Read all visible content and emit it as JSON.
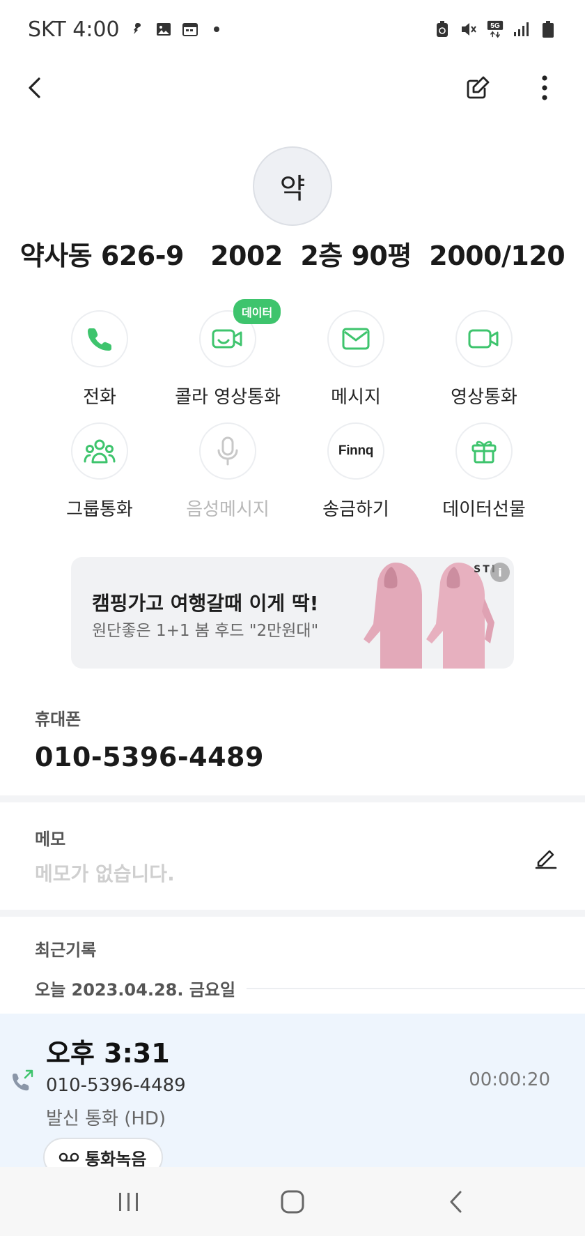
{
  "status_bar": {
    "carrier_time": "SKT 4:00",
    "network_badge": "5G",
    "icons_left": [
      "notification-icon",
      "image-icon",
      "calendar-icon",
      "dot-icon"
    ],
    "icons_right": [
      "battery-saver-icon",
      "mute-icon",
      "network-5g-icon",
      "signal-icon",
      "battery-icon"
    ]
  },
  "app_bar": {
    "back_icon": "back-arrow-icon",
    "edit_icon": "edit-icon",
    "more_icon": "more-vertical-icon"
  },
  "contact": {
    "avatar_initial": "약",
    "name": "약사동 626-9   2002  2층 90평  2000/120"
  },
  "actions": [
    {
      "label": "전화",
      "icon": "phone-icon",
      "enabled": true
    },
    {
      "label": "콜라 영상통화",
      "icon": "video-call-icon",
      "badge": "데이터",
      "enabled": true
    },
    {
      "label": "메시지",
      "icon": "message-icon",
      "enabled": true
    },
    {
      "label": "영상통화",
      "icon": "video-icon",
      "enabled": true
    },
    {
      "label": "그룹통화",
      "icon": "group-call-icon",
      "enabled": true
    },
    {
      "label": "음성메시지",
      "icon": "mic-icon",
      "enabled": false
    },
    {
      "label": "송금하기",
      "icon": "finnq-icon",
      "icon_text": "Finnq",
      "enabled": true
    },
    {
      "label": "데이터선물",
      "icon": "gift-icon",
      "enabled": true
    }
  ],
  "ad": {
    "title": "캠핑가고 여행갈때 이게 딱!",
    "subtitle": "원단좋은 1+1 봄 후드 \"2만원대\"",
    "brand": "STI",
    "info": "i"
  },
  "phone_section": {
    "label": "휴대폰",
    "number": "010-5396-4489"
  },
  "memo_section": {
    "label": "메모",
    "empty_text": "메모가 없습니다."
  },
  "recent_section": {
    "label": "최근기록",
    "date": "오늘 2023.04.28. 금요일",
    "call": {
      "time": "오후 3:31",
      "number": "010-5396-4489",
      "type": "발신 통화 (HD)",
      "duration": "00:00:20",
      "record_label": "통화녹음"
    }
  },
  "colors": {
    "accent_green": "#3ec46d",
    "call_card_bg": "#eef5fd",
    "disabled_text": "#b8b8b8"
  }
}
